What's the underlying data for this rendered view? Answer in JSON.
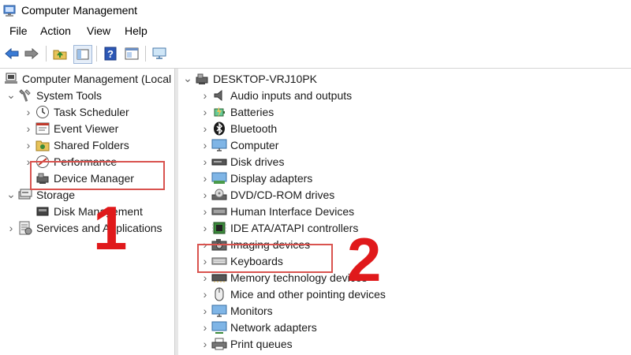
{
  "window": {
    "title": "Computer Management",
    "icon": "computer-management-icon"
  },
  "menu": {
    "file": "File",
    "action": "Action",
    "view": "View",
    "help": "Help"
  },
  "toolbar": {
    "buttons": [
      "back-arrow-icon",
      "forward-arrow-icon",
      "up-folder-icon",
      "show-hide-tree-icon",
      "help-icon",
      "properties-icon",
      "monitor-icon"
    ]
  },
  "left_tree": {
    "root": "Computer Management (Local",
    "system_tools": "System Tools",
    "task_scheduler": "Task Scheduler",
    "event_viewer": "Event Viewer",
    "shared_folders": "Shared Folders",
    "performance": "Performance",
    "device_manager": "Device Manager",
    "storage": "Storage",
    "disk_management": "Disk Management",
    "services_apps": "Services and Applications"
  },
  "device_tree": {
    "root": "DESKTOP-VRJ10PK",
    "items": [
      "Audio inputs and outputs",
      "Batteries",
      "Bluetooth",
      "Computer",
      "Disk drives",
      "Display adapters",
      "DVD/CD-ROM drives",
      "Human Interface Devices",
      "IDE ATA/ATAPI controllers",
      "Imaging devices",
      "Keyboards",
      "Memory technology devices",
      "Mice and other pointing devices",
      "Monitors",
      "Network adapters",
      "Print queues"
    ]
  },
  "annotations": {
    "step1": "1",
    "step2": "2"
  },
  "colors": {
    "annotation_red": "#e0191b",
    "annotation_box": "#d9534f"
  }
}
